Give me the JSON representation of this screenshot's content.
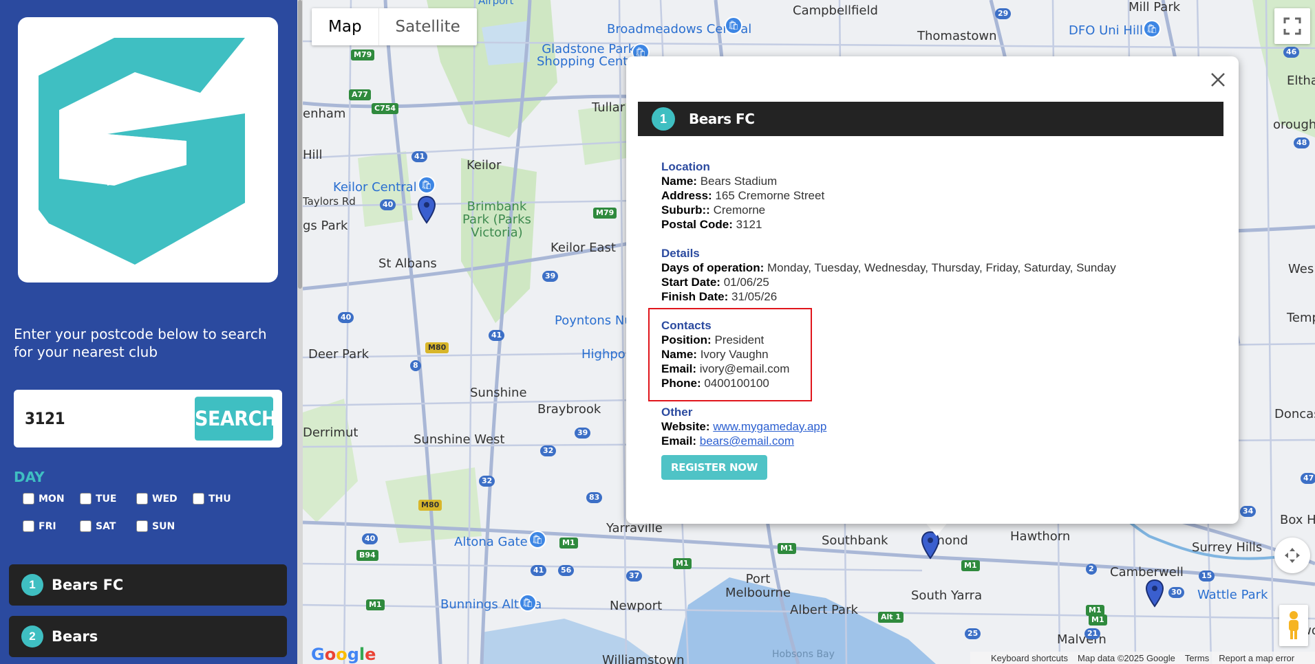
{
  "sidebar": {
    "intro_text": "Enter your postcode below to search for your nearest club",
    "search": {
      "value": "3121",
      "button_label": "SEARCH"
    },
    "day_title": "DAY",
    "days": [
      "MON",
      "TUE",
      "WED",
      "THU",
      "FRI",
      "SAT",
      "SUN"
    ],
    "clubs": [
      {
        "number": "1",
        "name": "Bears FC"
      },
      {
        "number": "2",
        "name": "Bears"
      }
    ]
  },
  "map": {
    "type_buttons": [
      "Map",
      "Satellite"
    ],
    "active_type": "Map",
    "labels": {
      "campbellfield": "Campbellfield",
      "mill_park": "Mill Park",
      "thomastown": "Thomastown",
      "broadmeadows": "Broadmeadows Central",
      "dfo": "DFO Uni Hill",
      "gladstone": "Gladstone Park\nShopping Centre",
      "airport": "Airport",
      "tullamarine": "Tullar",
      "keilor": "Keilor",
      "keilor_central": "Keilor Central",
      "brimbank": "Brimbank\nPark (Parks\nVictoria)",
      "keilor_east": "Keilor East",
      "st_albans": "St Albans",
      "kings_park": "gs Park",
      "hill": "Hill",
      "enham": "enham",
      "taylors_rd": "Taylors Rd",
      "deer_park": "Deer Park",
      "poyntons": "Poyntons Nu",
      "highpoint": "Highpo",
      "sunshine": "Sunshine",
      "braybrook": "Braybrook",
      "derrimut": "Derrimut",
      "sunshine_west": "Sunshine West",
      "yarraville": "Yarraville",
      "altona_gate": "Altona Gate",
      "bunnings": "Bunnings Altona",
      "newport": "Newport",
      "williamstown": "Williamstown",
      "port_melbourne": "Port\nMelbourne",
      "albert_park": "Albert Park",
      "southbank": "Southbank",
      "richmond": "hmond",
      "south_yarra": "South Yarra",
      "hawthorn": "Hawthorn",
      "camberwell": "Camberwell",
      "surrey_hills": "Surrey Hills",
      "wattle_park": "Wattle Park",
      "malvern": "Malvern",
      "burwood": "Burwo",
      "box_hill": "Box Hi",
      "doncaster": "Doncas",
      "hobsons_bay": "Hobsons Bay",
      "eltham": "Eltha",
      "orough": "orough",
      "wes": "Wes",
      "temp": "Temp"
    },
    "footer": [
      "Keyboard shortcuts",
      "Map data ©2025 Google",
      "Terms",
      "Report a map error"
    ],
    "google_logo": "Google"
  },
  "info_window": {
    "number": "1",
    "title": "Bears FC",
    "location": {
      "heading": "Location",
      "name_label": "Name:",
      "name": "Bears Stadium",
      "address_label": "Address:",
      "address": "165 Cremorne Street",
      "suburb_label": "Suburb::",
      "suburb": "Cremorne",
      "postal_label": "Postal Code:",
      "postal": "3121"
    },
    "details": {
      "heading": "Details",
      "days_label": "Days of operation:",
      "days": "Monday, Tuesday, Wednesday, Thursday, Friday, Saturday, Sunday",
      "start_label": "Start Date:",
      "start": "01/06/25",
      "finish_label": "Finish Date:",
      "finish": "31/05/26"
    },
    "contacts": {
      "heading": "Contacts",
      "position_label": "Position:",
      "position": "President",
      "name_label": "Name:",
      "name": "Ivory Vaughn",
      "email_label": "Email:",
      "email": "ivory@email.com",
      "phone_label": "Phone:",
      "phone": "0400100100"
    },
    "other": {
      "heading": "Other",
      "website_label": "Website:",
      "website": "www.mygameday.app",
      "email_label": "Email:",
      "email": "bears@email.com"
    },
    "register_label": "REGISTER NOW"
  },
  "colors": {
    "accent": "#3fbfc2",
    "sidebar": "#2b4a9f",
    "header": "#232323",
    "highlight": "#e0151b"
  }
}
